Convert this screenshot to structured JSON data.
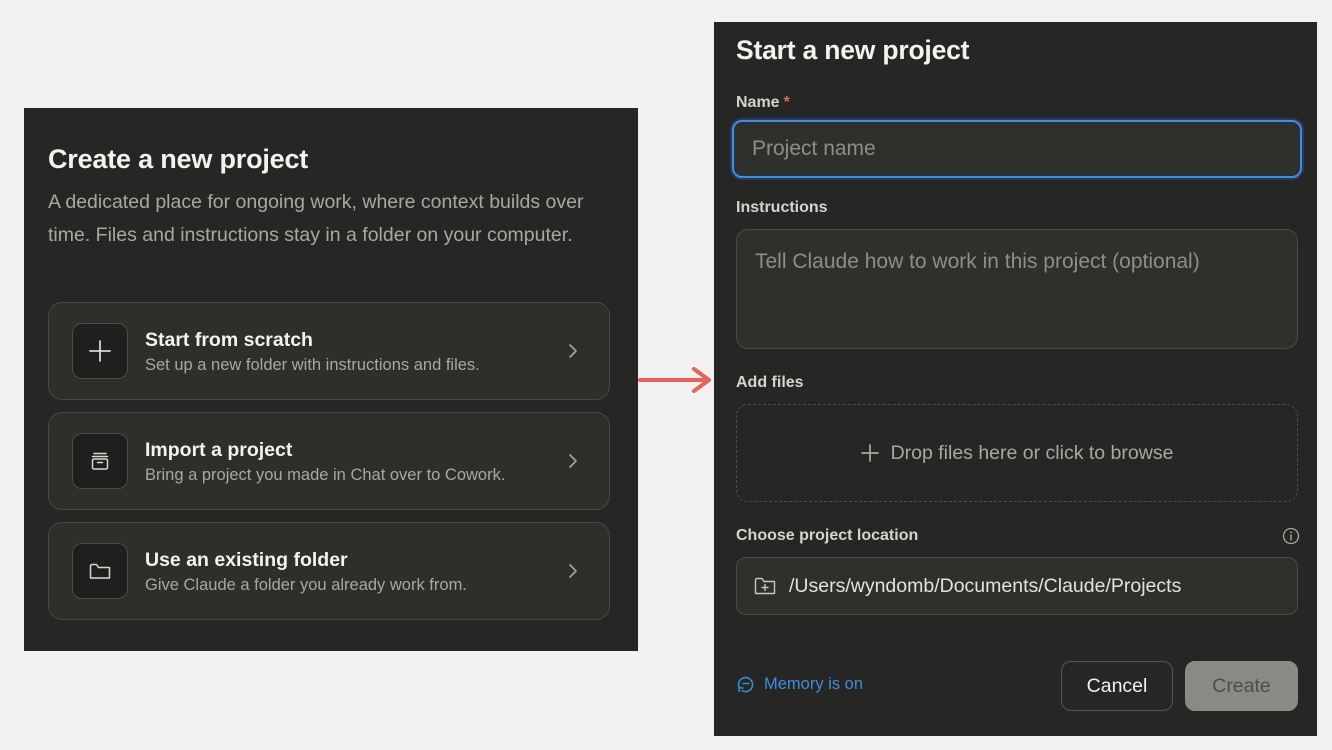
{
  "left_panel": {
    "title": "Create a new project",
    "description": "A dedicated place for ongoing work, where context builds over time. Files and instructions stay in a folder on your computer.",
    "options": [
      {
        "title": "Start from scratch",
        "subtitle": "Set up a new folder with instructions and files.",
        "icon": "plus-icon"
      },
      {
        "title": "Import a project",
        "subtitle": "Bring a project you made in Chat over to Cowork.",
        "icon": "archive-icon"
      },
      {
        "title": "Use an existing folder",
        "subtitle": "Give Claude a folder you already work from.",
        "icon": "folder-icon"
      }
    ]
  },
  "connector": {
    "color": "#e8625a",
    "icon": "arrow-right-icon"
  },
  "right_panel": {
    "title": "Start a new project",
    "name_label": "Name",
    "required_marker": "*",
    "name_value": "",
    "name_placeholder": "Project name",
    "instructions_label": "Instructions",
    "instructions_value": "",
    "instructions_placeholder": "Tell Claude how to work in this project (optional)",
    "add_files_label": "Add files",
    "dropzone_text": "Drop files here or click to browse",
    "location_label": "Choose project location",
    "location_path": "/Users/wyndomb/Documents/Claude/Projects",
    "memory_text": "Memory is on",
    "cancel_label": "Cancel",
    "create_label": "Create"
  },
  "colors": {
    "panel_bg": "#262624",
    "focus_ring": "#3a8ef0",
    "link_blue": "#3b8ede",
    "required_red": "#e06a5a"
  }
}
